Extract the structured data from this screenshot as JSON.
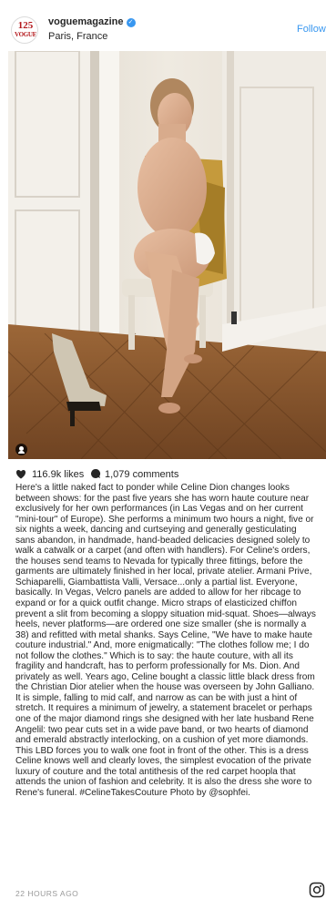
{
  "header": {
    "avatar_logo_top": "125",
    "avatar_logo_bottom": "VOGUE",
    "username": "voguemagazine",
    "location": "Paris, France",
    "follow_label": "Follow"
  },
  "photo": {
    "alt_icon": "person-tag-icon"
  },
  "stats": {
    "likes": "116.9k likes",
    "comments": "1,079 comments"
  },
  "caption": {
    "text": "Here's a little naked fact to ponder while Celine Dion changes looks between shows: for the past five years she has worn haute couture near exclusively for her own performances (in Las Vegas and on her current \"mini-tour\" of Europe). She performs a minimum two hours a night, five or six nights a week, dancing and curtseying and generally gesticulating sans abandon, in handmade, hand-beaded delicacies designed solely to walk a catwalk or a carpet (and often with handlers). For Celine's orders, the houses send teams to Nevada for typically three fittings, before the garments are ultimately finished in her local, private atelier. Armani Prive, Schiaparelli, Giambattista Valli, Versace...only a partial list. Everyone, basically. In Vegas, Velcro panels are added to allow for her ribcage to expand or for a quick outfit change. Micro straps of elasticized chiffon prevent a slit from becoming a sloppy situation mid-squat. Shoes—always heels, never platforms—are ordered one size smaller (she is normally a 38) and refitted with metal shanks. Says Celine, \"We have to make haute couture industrial.\" And, more enigmatically: \"The clothes follow me; I do not follow the clothes.\" Which is to say: the haute couture, with all its fragility and handcraft, has to perform professionally for Ms. Dion. And privately as well. Years ago, Celine bought a classic little black dress from the Christian Dior atelier when the house was overseen by John Galliano. It is simple, falling to mid calf, and narrow as can be with just a hint of stretch. It requires a minimum of jewelry, a statement bracelet or perhaps one of the major diamond rings she designed with her late husband Rene Angelil: two pear cuts set in a wide pave band, or two hearts of diamond and emerald abstractly interlocking, on a cushion of yet more diamonds. This LBD forces you to walk one foot in front of the other. This is a dress Celine knows well and clearly loves, the simplest evocation of the private luxury of couture and the total antithesis of the red carpet hoopla that attends the union of fashion and celebrity. It is also the dress she wore to Rene's funeral. #CelineTakesCouture Photo by @sophfei."
  },
  "footer": {
    "timestamp": "22 HOURS AGO"
  },
  "colors": {
    "link": "#3897f0",
    "text": "#262626",
    "muted": "#999999"
  }
}
